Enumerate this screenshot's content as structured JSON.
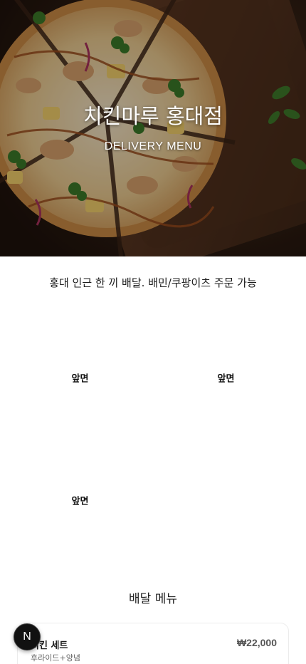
{
  "hero": {
    "title": "치킨마루 홍대점",
    "subtitle": "DELIVERY MENU"
  },
  "tagline": "홍대 인근 한 끼 배달. 배민/쿠팡이츠 주문 가능",
  "photos": [
    {
      "label": "앞면"
    },
    {
      "label": "앞면"
    },
    {
      "label": "앞면"
    }
  ],
  "section": {
    "title": "배달 메뉴"
  },
  "menu": [
    {
      "name": "치킨 세트",
      "desc": "후라이드+양념",
      "price": "₩22,000"
    }
  ],
  "fab": {
    "letter": "N"
  },
  "colors": {
    "accent": "#111111",
    "crust": "#d9a35a",
    "board": "#5a3520"
  },
  "icons": {
    "hero_image": "pizza-on-board-photo"
  }
}
